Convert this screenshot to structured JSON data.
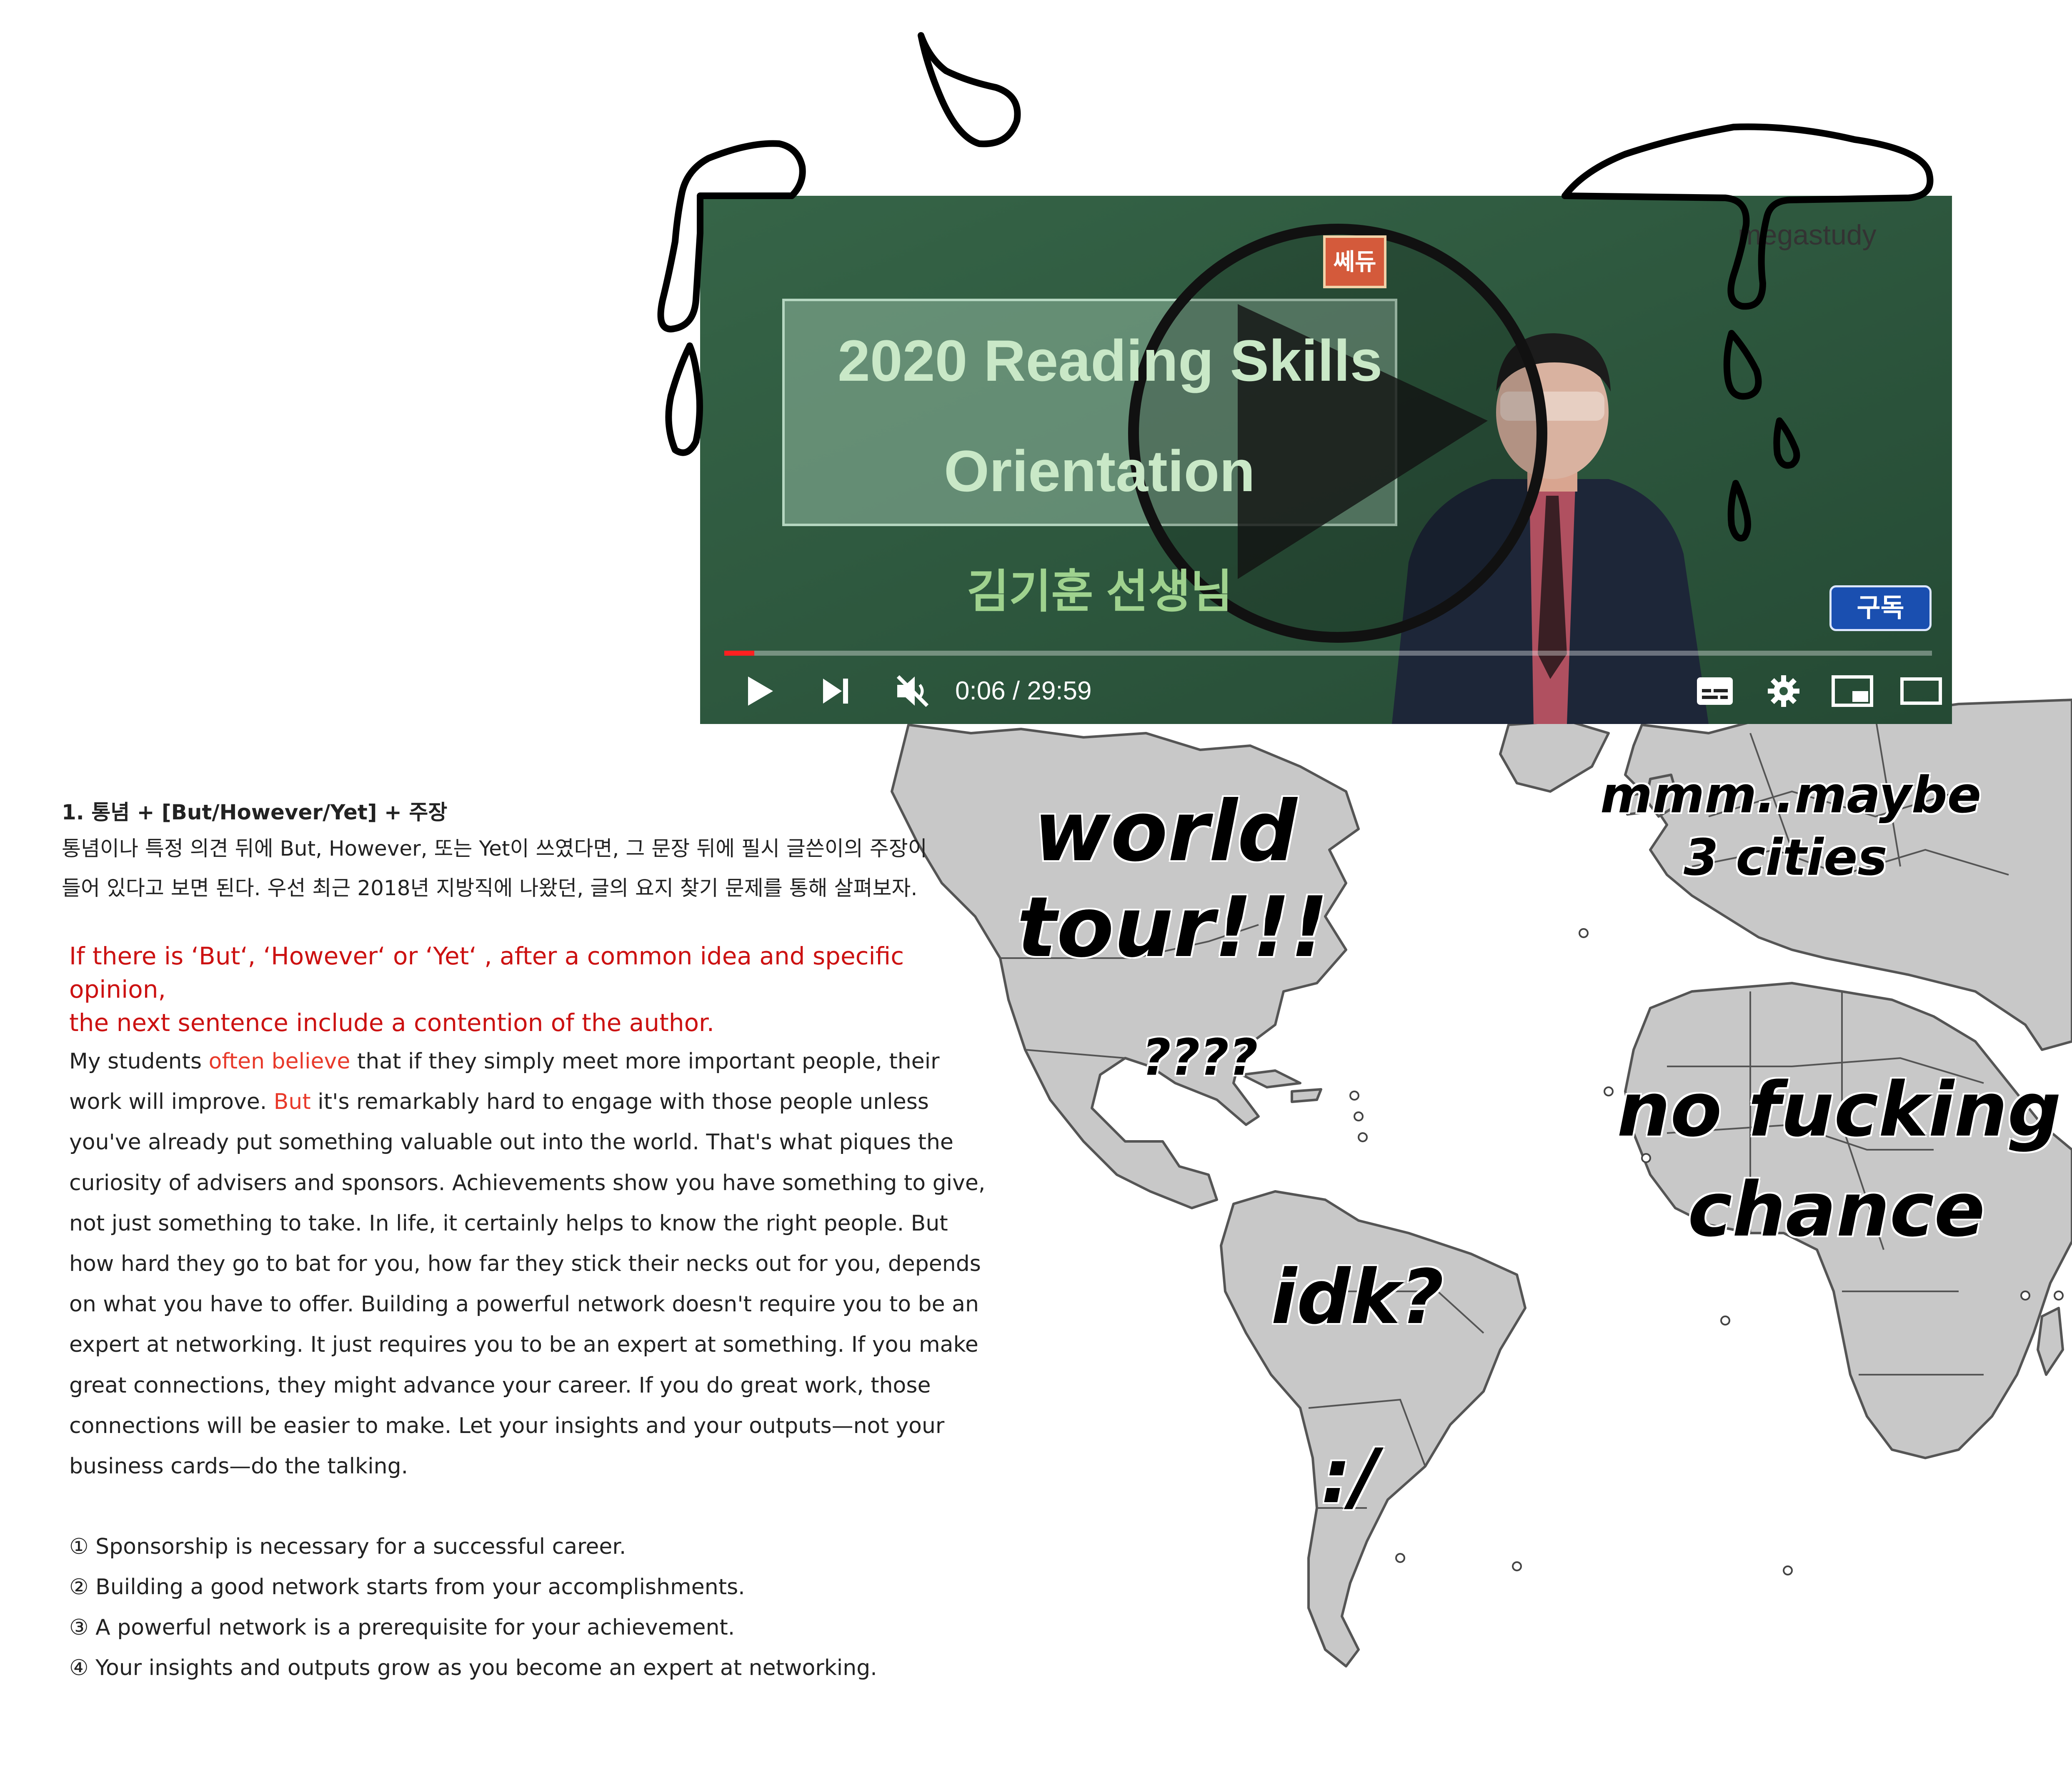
{
  "video": {
    "title_line_1": "2020 Reading Skills",
    "title_line_2": "Orientation",
    "teacher": "김기훈 선생님",
    "badge": "쎄듀",
    "brand": "megastudy",
    "subscribe": "구독",
    "current_time": "0:06",
    "duration": "29:59",
    "time_display": "0:06 / 29:59",
    "progress_fraction": 0.0034,
    "icons": [
      "play-icon",
      "next-icon",
      "muted-volume-icon",
      "subtitles-icon",
      "settings-icon",
      "miniplayer-icon",
      "theater-icon",
      "fullscreen-icon",
      "big-play-icon"
    ]
  },
  "map": {
    "labels": {
      "world_tour_1": "world",
      "world_tour_2": "tour!!!",
      "central_america": "????",
      "europe_1": "mmm..maybe",
      "europe_2": "3 cities",
      "africa_1": "no fucking",
      "africa_2": "chance",
      "south_america": "idk?",
      "patagonia": ":/"
    }
  },
  "article": {
    "heading": "1. 통념 + [But/However/Yet] + 주장",
    "intro_line_1": "통념이나 특정 의견 뒤에 But, However, 또는 Yet이 쓰였다면, 그 문장 뒤에 필시 글쓴이의 주장이",
    "intro_line_2": "들어 있다고 보면 된다. 우선 최근 2018년 지방직에 나왔던, 글의 요지 찾기 문제를 통해 살펴보자.",
    "translation_line_1": "If there is ‘But‘, ‘However‘ or ‘Yet‘ , after a common idea and specific opinion,",
    "translation_line_2": "the next sentence include a contention of the author.",
    "passage_part_1": "My students ",
    "passage_highlight_1": "often believe",
    "passage_part_2": " that if they simply meet more important people, their work will improve. ",
    "passage_highlight_2": "But",
    "passage_part_3": " it's remarkably hard to engage with those people unless you've already put something valuable out into the world. That's what piques the curiosity of advisers and sponsors. Achievements show you have something to give, not just something to take. In life, it certainly helps to know the right people. But how hard they go to bat for you, how far they stick their necks out for you, depends on what you have to offer. Building a powerful network doesn't require you to be an expert at networking. It just requires you to be an expert at something. If you make great connections, they might advance your career. If you do great work, those connections will be easier to make. Let your insights and your outputs—not your business cards—do the talking.",
    "options": [
      "① Sponsorship is necessary for a successful career.",
      "② Building a good network starts from your accomplishments.",
      "③ A powerful network is a prerequisite for your achievement.",
      "④ Your insights and outputs grow as you become an expert at networking."
    ]
  },
  "colors": {
    "map_land": "#c8c8c8",
    "map_border": "#555555",
    "board_green": "#2f5a40",
    "translation_red": "#cc1111",
    "highlight_red": "#e8392a",
    "progress_red": "#ff2020"
  }
}
